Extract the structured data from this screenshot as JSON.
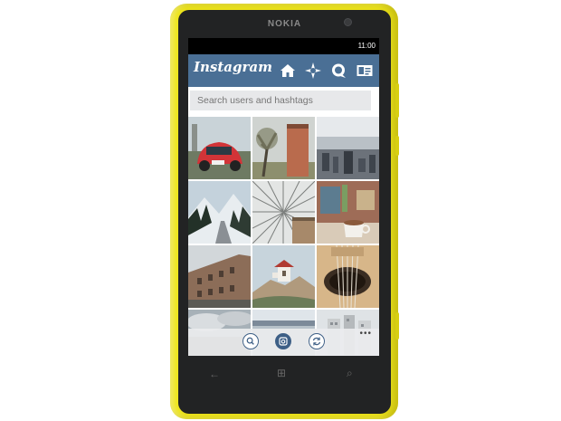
{
  "device": {
    "brand": "NOKIA",
    "status_time": "11:00",
    "hardware_keys": {
      "back": "←",
      "start": "⊞",
      "search": "⌕"
    }
  },
  "app": {
    "logo_text": "Instagram",
    "nav_icons": [
      "home-icon",
      "explore-icon",
      "news-icon",
      "profile-icon"
    ],
    "search": {
      "placeholder": "Search users and hashtags",
      "value": ""
    },
    "app_bar": {
      "buttons": [
        "search-icon",
        "camera-icon",
        "refresh-icon"
      ],
      "more": "•••"
    }
  },
  "photos": [
    {
      "subject": "red-beetle-car"
    },
    {
      "subject": "tree-and-tower"
    },
    {
      "subject": "aerial-city"
    },
    {
      "subject": "snowy-mountain-road"
    },
    {
      "subject": "glass-dome-roof"
    },
    {
      "subject": "coffee-cup-table"
    },
    {
      "subject": "old-building-street"
    },
    {
      "subject": "lighthouse-on-rocks"
    },
    {
      "subject": "guitar-soundhole"
    },
    {
      "subject": "clouds-landscape"
    },
    {
      "subject": "coast-horizon"
    },
    {
      "subject": "buildings-under-sky"
    }
  ],
  "colors": {
    "phone_body": "#eee51a",
    "header": "#4a6f95",
    "accent": "#3d5f86"
  }
}
